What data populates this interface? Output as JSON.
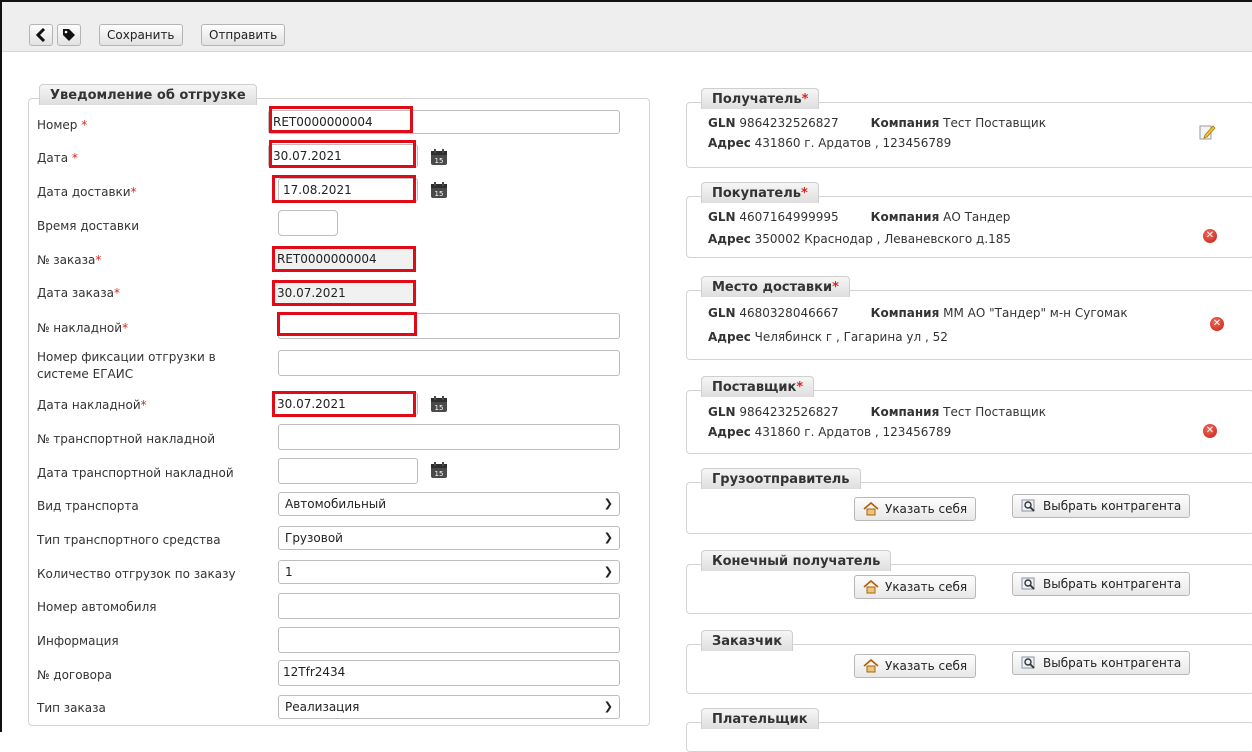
{
  "toolbar": {
    "save_label": "Сохранить",
    "send_label": "Отправить"
  },
  "shipment": {
    "legend": "Уведомление об отгрузке",
    "fields": {
      "number": {
        "label": "Номер",
        "value": "RET0000000004"
      },
      "date": {
        "label": "Дата",
        "value": "30.07.2021"
      },
      "delivery_date": {
        "label": "Дата доставки",
        "value": "17.08.2021"
      },
      "delivery_time": {
        "label": "Время доставки",
        "value": ""
      },
      "order_number": {
        "label": "№ заказа",
        "value": "RET0000000004"
      },
      "order_date": {
        "label": "Дата заказа",
        "value": "30.07.2021"
      },
      "invoice_number": {
        "label": "№ накладной",
        "value": ""
      },
      "egais_number": {
        "label_line1": "Номер фиксации отгрузки в",
        "label_line2": "системе ЕГАИС",
        "value": ""
      },
      "invoice_date": {
        "label": "Дата накладной",
        "value": "30.07.2021"
      },
      "transport_invoice_number": {
        "label": "№ транспортной накладной",
        "value": ""
      },
      "transport_invoice_date": {
        "label": "Дата транспортной накладной",
        "value": ""
      },
      "transport_kind": {
        "label": "Вид транспорта",
        "value": "Автомобильный"
      },
      "vehicle_type": {
        "label": "Тип транспортного средства",
        "value": "Грузовой"
      },
      "shipments_count": {
        "label": "Количество отгрузок по заказу",
        "value": "1"
      },
      "car_number": {
        "label": "Номер автомобиля",
        "value": ""
      },
      "info": {
        "label": "Информация",
        "value": ""
      },
      "contract_number": {
        "label": "№ договора",
        "value": "12Tfr2434"
      },
      "order_type": {
        "label": "Тип заказа",
        "value": "Реализация"
      }
    }
  },
  "parties": {
    "gln_label": "GLN",
    "company_label": "Компания",
    "address_label": "Адрес",
    "required_mark": "*",
    "recipient": {
      "title": "Получатель",
      "gln": "9864232526827",
      "company": "Тест Поставщик",
      "address": "431860 г. Ардатов , 123456789"
    },
    "buyer": {
      "title": "Покупатель",
      "gln": "4607164999995",
      "company": "АО Тандер",
      "address": "350002 Краснодар , Леваневского д.185"
    },
    "delivery_place": {
      "title": "Место доставки",
      "gln": "4680328046667",
      "company": "ММ АО \"Тандер\" м-н Сугомак",
      "address": "Челябинск г , Гагарина ул , 52"
    },
    "supplier": {
      "title": "Поставщик",
      "gln": "9864232526827",
      "company": "Тест Поставщик",
      "address": "431860 г. Ардатов , 123456789"
    },
    "shipper": {
      "title": "Грузоотправитель"
    },
    "final_recipient": {
      "title": "Конечный получатель"
    },
    "customer": {
      "title": "Заказчик"
    },
    "payer": {
      "title": "Плательщик"
    },
    "set_self_label": "Указать себя",
    "choose_contractor_label": "Выбрать контрагента"
  },
  "colors": {
    "required": "#d9261c",
    "highlight": "#e10a17",
    "remove": "#c51f13"
  }
}
